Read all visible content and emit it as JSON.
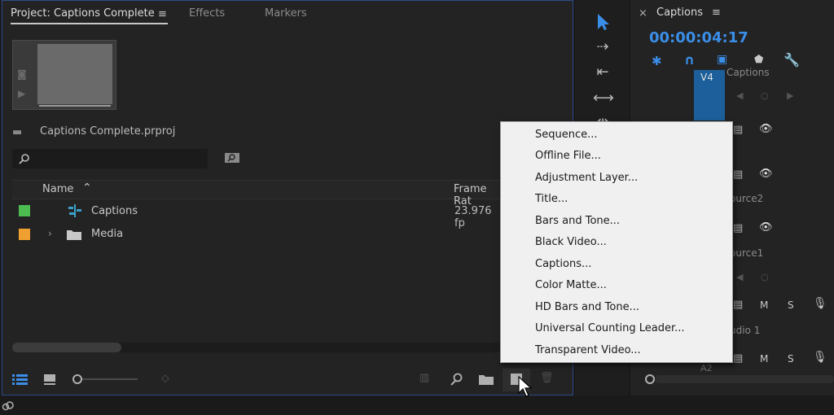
{
  "project_panel": {
    "tabs": [
      "Project: Captions Complete",
      "Effects",
      "Markers"
    ],
    "project_file": "Captions Complete.prproj",
    "columns": {
      "name": "Name",
      "frame_rate": "Frame Rat"
    },
    "items": [
      {
        "name": "Captions",
        "frame_rate": "23.976 fp",
        "color": "#4cbb50",
        "icon": "captions-sequence-icon"
      },
      {
        "name": "Media",
        "frame_rate": "",
        "color": "#f0a030",
        "icon": "folder-icon"
      }
    ]
  },
  "timeline": {
    "title": "Captions",
    "timecode": "00:00:04:17",
    "track_labels": {
      "v4": "V4",
      "captions": "Captions",
      "source2": "ource2",
      "source1": "ource1",
      "audio1": "udio 1",
      "a2": "A2"
    },
    "mute_label": "M",
    "solo_label": "S"
  },
  "context_menu": {
    "items": [
      "Sequence...",
      "Offline File...",
      "Adjustment Layer...",
      "Title...",
      "Bars and Tone...",
      "Black Video...",
      "Captions...",
      "Color Matte...",
      "HD Bars and Tone...",
      "Universal Counting Leader...",
      "Transparent Video..."
    ]
  },
  "colors": {
    "accent": "#2a7fd4",
    "panel_border": "#2c4a8a",
    "timecode": "#3a8ee8"
  }
}
